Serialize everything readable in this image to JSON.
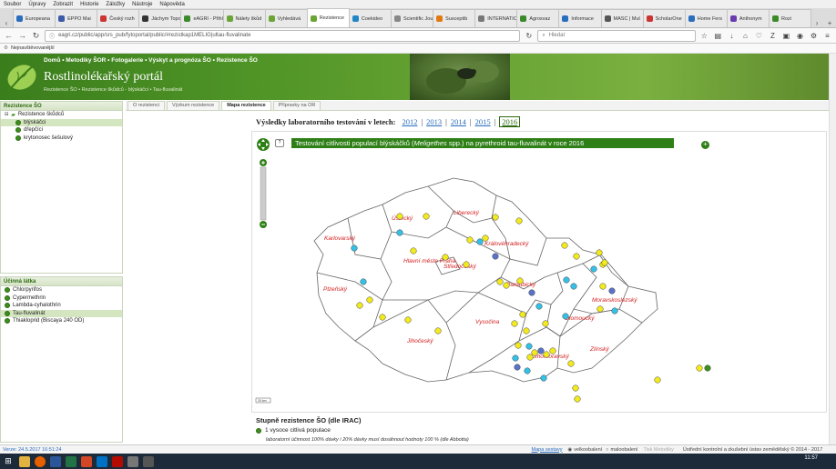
{
  "menubar": [
    "Soubor",
    "Úpravy",
    "Zobrazit",
    "Historie",
    "Záložky",
    "Nástroje",
    "Nápověda"
  ],
  "tabs": [
    {
      "label": "Europeana",
      "color": "#2a6dbf"
    },
    {
      "label": "EPPO Mai",
      "color": "#3b5aa8"
    },
    {
      "label": "Český rozh",
      "color": "#c33"
    },
    {
      "label": "Jáchym Topo",
      "color": "#333"
    },
    {
      "label": "eAGRI - Přihlá",
      "color": "#3a8a2a"
    },
    {
      "label": "Nálety škůd",
      "color": "#6aa535"
    },
    {
      "label": "Vyhledává",
      "color": "#6aa535"
    },
    {
      "label": "Rezistence",
      "color": "#6aa535",
      "active": true
    },
    {
      "label": "Coekideo",
      "color": "#1f86c7"
    },
    {
      "label": "Scientific Journ",
      "color": "#888"
    },
    {
      "label": "Susceptib",
      "color": "#e07a10"
    },
    {
      "label": "INTERNATION",
      "color": "#777"
    },
    {
      "label": "Agrosvaz",
      "color": "#3a8a2a"
    },
    {
      "label": "Informace",
      "color": "#2a6dbf"
    },
    {
      "label": "MASC | Mul",
      "color": "#555"
    },
    {
      "label": "ScholarOne",
      "color": "#c33"
    },
    {
      "label": "Home Fers",
      "color": "#2a6dbf"
    },
    {
      "label": "Anthonym",
      "color": "#6a3ab0"
    },
    {
      "label": "Rozi",
      "color": "#3a8a2a"
    }
  ],
  "nav": {
    "url": "eagri.cz/public/app/srs_pub/fytoportal/public/#rezistkap1MELIG|ultau-fluvalinate",
    "search_placeholder": "Hledat"
  },
  "bookmarks": {
    "label": "Nejnavštěvovanější"
  },
  "banner": {
    "links": "Domů  •  Metodiky ŠOR  •  Fotogalerie  •  Výskyt a prognóza ŠO  •  Rezistence ŠO",
    "title": "Rostlinolékařský portál",
    "breadcrumb": "Rezistence ŠO  •  Rezistence škůdců - blýskáčci  •  Tau-fluvalinát"
  },
  "left_panel_top": {
    "title": "Rezistence ŠO",
    "root": "Rezistence škůdců",
    "items": [
      {
        "label": "blýskáčci",
        "selected": true
      },
      {
        "label": "dřepčíci",
        "selected": false
      },
      {
        "label": "krytonosec šešulový",
        "selected": false
      }
    ]
  },
  "left_panel_bottom": {
    "title": "Účinná látka",
    "items": [
      {
        "label": "Chlorpyrifos",
        "selected": false
      },
      {
        "label": "Cypermethrin",
        "selected": false
      },
      {
        "label": "Lambda-cyhalothrin",
        "selected": false
      },
      {
        "label": "Tau-fluvalinát",
        "selected": true
      },
      {
        "label": "Thiakloprid (Biscaya 240 OD)",
        "selected": false
      }
    ]
  },
  "content_tabs": [
    {
      "label": "O rezistenci",
      "active": false
    },
    {
      "label": "Výzkum rezistence",
      "active": false
    },
    {
      "label": "Mapa rezistence",
      "active": true
    },
    {
      "label": "Přípravky na OR",
      "active": false
    }
  ],
  "years": {
    "prefix": "Výsledky laboratorního testování v letech:",
    "items": [
      "2012",
      "2013",
      "2014",
      "2015",
      "2016"
    ],
    "current": "2016"
  },
  "map_title_parts": {
    "a": "Testování citlivosti populací blýskáčků (",
    "b": "Meligethes",
    "c": " spp.) na pyrethroid tau-fluvalinát v roce 2016"
  },
  "regions": [
    "Ústecký",
    "Liberecký",
    "Karlovarský",
    "Královéhradecký",
    "Hlavní město Praha",
    "Středočeský",
    "Pardubický",
    "Plzeňský",
    "Olomoucký",
    "Moravskoslezský",
    "Vysočina",
    "Jihočeský",
    "Jihomoravský",
    "Zlínský"
  ],
  "scale_label": "20 km",
  "legend": {
    "title": "Stupně rezistence ŠO (dle IRAC)",
    "level": "1 vysoce citlivá populace",
    "note": "laboratorní účinnost 100% dávky i 20% dávky musí dosáhnout hodnoty 100 % (dle Abbotta)"
  },
  "statusbar": {
    "version": "Verze: 24.5.2017 16:51:24",
    "help": "Mapa sestavy",
    "radio1": "velkoobalení",
    "radio2": "maloobalení",
    "pdf": "Tisk Metodiky",
    "footer": "Ústřední kontrolní a zkušební ústav zemědělský © 2014 - 2017"
  },
  "clock": {
    "time": "11:57",
    "date": "23.04.2017"
  },
  "colors": {
    "green": "#2e7f16",
    "dot_yellow": "#f3ea1e",
    "dot_cyan": "#35c0e6",
    "dot_blue": "#5a72c8"
  }
}
